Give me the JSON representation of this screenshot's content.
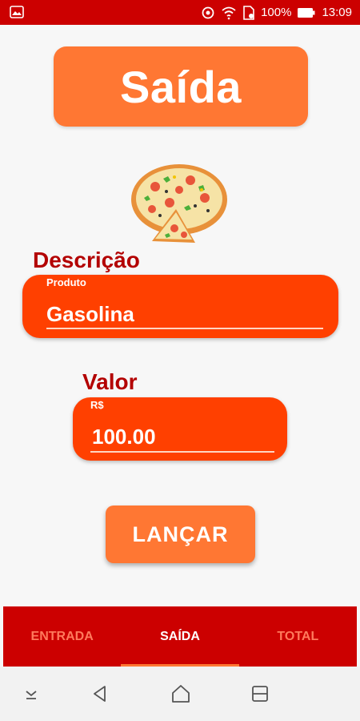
{
  "status_bar": {
    "battery": "100%",
    "time": "13:09",
    "icons": [
      "image-icon",
      "sync-icon",
      "wifi-icon",
      "sim-icon",
      "battery-icon"
    ]
  },
  "title": "Saída",
  "image": "pizza-icon",
  "descricao": {
    "label": "Descrição",
    "hint": "Produto",
    "value": "Gasolina"
  },
  "valor": {
    "label": "Valor",
    "hint": "R$",
    "value": "100.00"
  },
  "button": {
    "label": "LANÇAR"
  },
  "tabs": [
    {
      "label": "ENTRADA",
      "active": false
    },
    {
      "label": "SAÍDA",
      "active": true
    },
    {
      "label": "TOTAL",
      "active": false
    }
  ],
  "nav": [
    "down-arrow-icon",
    "back-icon",
    "home-icon",
    "recents-icon"
  ],
  "colors": {
    "status_bar": "#cc0000",
    "accent_orange": "#ff7733",
    "field_orange": "#ff4000",
    "label_red": "#b30000",
    "tab_bar": "#cc0000"
  }
}
